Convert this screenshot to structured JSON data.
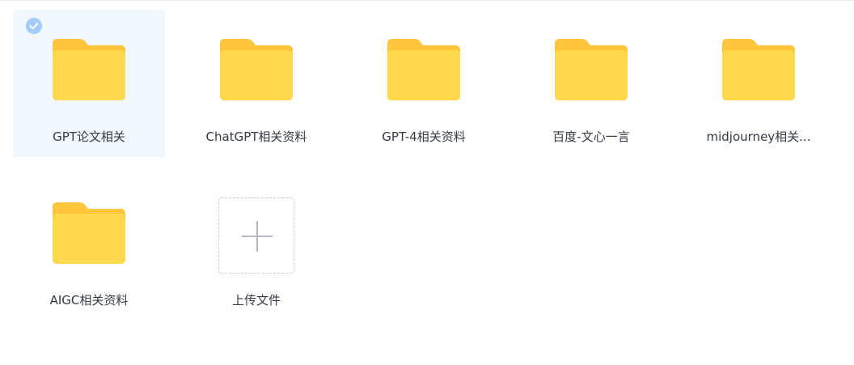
{
  "colors": {
    "selection_bg": "#f0f7ff",
    "check_badge": "#a3cdfa",
    "folder_back": "#ffc53d",
    "folder_front": "#ffd84d",
    "label_text": "#333a46",
    "upload_border": "#c8cdd4",
    "plus": "#b5bac2"
  },
  "items": [
    {
      "type": "folder",
      "label": "GPT论文相关",
      "selected": true,
      "icon": "folder-icon"
    },
    {
      "type": "folder",
      "label": "ChatGPT相关资料",
      "selected": false,
      "icon": "folder-icon"
    },
    {
      "type": "folder",
      "label": "GPT-4相关资料",
      "selected": false,
      "icon": "folder-icon"
    },
    {
      "type": "folder",
      "label": "百度-文心一言",
      "selected": false,
      "icon": "folder-icon"
    },
    {
      "type": "folder",
      "label": "midjourney相关...",
      "selected": false,
      "icon": "folder-icon"
    },
    {
      "type": "folder",
      "label": "AIGC相关资料",
      "selected": false,
      "icon": "folder-icon"
    }
  ],
  "upload": {
    "label": "上传文件",
    "icon": "plus-icon"
  }
}
